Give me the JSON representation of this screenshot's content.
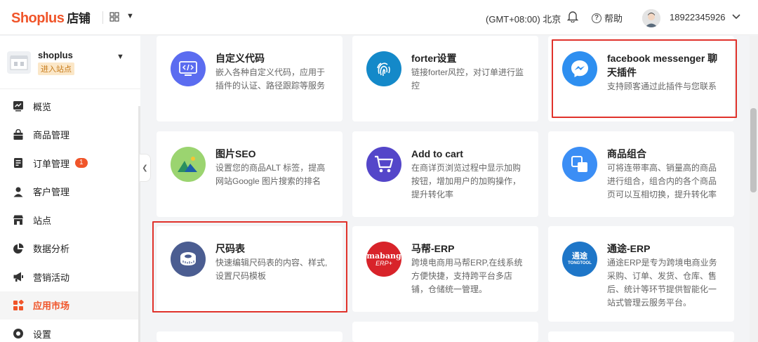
{
  "header": {
    "logo_en": "Shoplus",
    "logo_cn": "店铺",
    "apps_icon": "grid-icon",
    "timezone": "(GMT+08:00) 北京",
    "help_label": "帮助",
    "phone": "18922345926"
  },
  "sidebar": {
    "store_name": "shoplus",
    "enter_label": "进入站点",
    "items": [
      {
        "label": "概览",
        "icon": "overview-icon"
      },
      {
        "label": "商品管理",
        "icon": "bag-icon"
      },
      {
        "label": "订单管理",
        "icon": "order-icon",
        "badge": "1"
      },
      {
        "label": "客户管理",
        "icon": "user-icon"
      },
      {
        "label": "站点",
        "icon": "store-icon"
      },
      {
        "label": "数据分析",
        "icon": "pie-chart-icon"
      },
      {
        "label": "营销活动",
        "icon": "megaphone-icon"
      },
      {
        "label": "应用市场",
        "icon": "apps-icon",
        "active": true
      },
      {
        "label": "设置",
        "icon": "settings-icon"
      }
    ]
  },
  "cards": [
    {
      "title": "自定义代码",
      "desc": "嵌入各种自定义代码，应用于插件的认证、路径跟踪等服务",
      "icon": "code-icon",
      "color": "#5b6cf0"
    },
    {
      "title": "forter设置",
      "desc": "链接forter风控，对订单进行监控",
      "icon": "fingerprint-icon",
      "color": "#1489c9"
    },
    {
      "title": "facebook messenger 聊天插件",
      "desc": "支持顾客通过此插件与您联系",
      "icon": "messenger-icon",
      "color": "#2e8ff0"
    },
    {
      "title": "图片SEO",
      "desc": "设置您的商品ALT 标签，提高网站Google 图片搜索的排名",
      "icon": "image-seo-icon",
      "color": "#9bd470"
    },
    {
      "title": "Add to cart",
      "desc": "在商详页浏览过程中显示加购按钮，增加用户的加购操作，提升转化率",
      "icon": "cart-icon",
      "color": "#5446c9"
    },
    {
      "title": "商品组合",
      "desc": "可将连带率高、销量高的商品进行组合，组合内的各个商品页可以互相切换，提升转化率",
      "icon": "combine-icon",
      "color": "#3b8ef5"
    },
    {
      "title": "尺码表",
      "desc": "快速编辑尺码表的内容、样式,设置尺码模板",
      "icon": "tape-measure-icon",
      "color": "#4b5d91"
    },
    {
      "title": "马帮-ERP",
      "desc": "跨境电商用马帮ERP,在线系统方便快捷，支持跨平台多店铺，仓储统一管理。",
      "icon": "mabang-logo",
      "logo_text": "mabang",
      "logo_sub": "ERP+",
      "color": "#d8232a"
    },
    {
      "title": "通途-ERP",
      "desc": "通途ERP是专为跨境电商业务采购、订单、发货、仓库、售后、统计等环节提供智能化一站式管理云服务平台。",
      "icon": "tongtool-logo",
      "logo_cn": "通途",
      "logo_en": "TONGTOOL",
      "color": "#1e76c8"
    }
  ]
}
